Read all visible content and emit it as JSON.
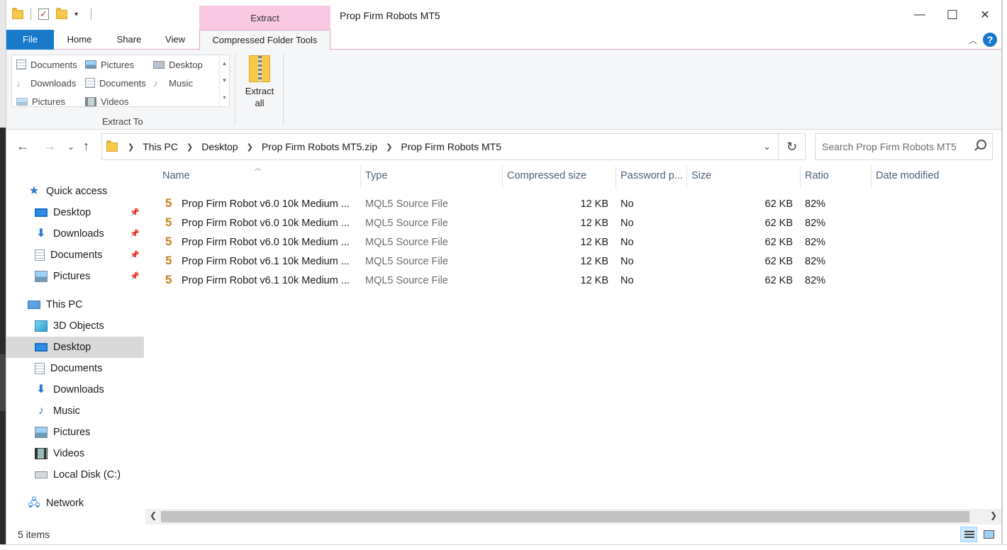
{
  "window": {
    "title": "Prop Firm Robots MT5",
    "contextual_tab_header": "Extract",
    "minimize_glyph": "—",
    "maximize_glyph": "☐",
    "close_glyph": "✕"
  },
  "quick_access_toolbar": {
    "dropdown_glyph": "▾",
    "icons": [
      "folder-icon",
      "properties-icon",
      "new-folder-icon"
    ]
  },
  "tabs": {
    "file": "File",
    "home": "Home",
    "share": "Share",
    "view": "View",
    "compressed": "Compressed Folder Tools"
  },
  "ribbon": {
    "extract_to_items": [
      {
        "label": "Documents",
        "icon": "documents-icon"
      },
      {
        "label": "Pictures",
        "icon": "pictures-icon"
      },
      {
        "label": "Desktop",
        "icon": "desktop-icon"
      },
      {
        "label": "Downloads",
        "icon": "downloads-icon"
      },
      {
        "label": "Documents",
        "icon": "documents-icon"
      },
      {
        "label": "Music",
        "icon": "music-icon"
      },
      {
        "label": "Pictures",
        "icon": "pictures-icon"
      },
      {
        "label": "Videos",
        "icon": "videos-icon"
      }
    ],
    "group_label": "Extract To",
    "extract_all_line1": "Extract",
    "extract_all_line2": "all"
  },
  "address": {
    "crumbs": [
      "This PC",
      "Desktop",
      "Prop Firm Robots MT5.zip",
      "Prop Firm Robots MT5"
    ],
    "search_placeholder": "Search Prop Firm Robots MT5"
  },
  "nav_pane": {
    "quick_access": "Quick access",
    "quick_items": [
      "Desktop",
      "Downloads",
      "Documents",
      "Pictures"
    ],
    "this_pc": "This PC",
    "pc_items": [
      "3D Objects",
      "Desktop",
      "Documents",
      "Downloads",
      "Music",
      "Pictures",
      "Videos",
      "Local Disk (C:)"
    ],
    "selected": "Desktop",
    "network": "Network"
  },
  "columns": {
    "name": "Name",
    "type": "Type",
    "compressed_size": "Compressed size",
    "password": "Password p...",
    "size": "Size",
    "ratio": "Ratio",
    "date_modified": "Date modified"
  },
  "files": [
    {
      "name": "Prop Firm Robot v6.0 10k Medium ...",
      "type": "MQL5 Source File",
      "compressed_size": "12 KB",
      "password": "No",
      "size": "62 KB",
      "ratio": "82%"
    },
    {
      "name": "Prop Firm Robot v6.0 10k Medium ...",
      "type": "MQL5 Source File",
      "compressed_size": "12 KB",
      "password": "No",
      "size": "62 KB",
      "ratio": "82%"
    },
    {
      "name": "Prop Firm Robot v6.0 10k Medium ...",
      "type": "MQL5 Source File",
      "compressed_size": "12 KB",
      "password": "No",
      "size": "62 KB",
      "ratio": "82%"
    },
    {
      "name": "Prop Firm Robot v6.1 10k Medium ...",
      "type": "MQL5 Source File",
      "compressed_size": "12 KB",
      "password": "No",
      "size": "62 KB",
      "ratio": "82%"
    },
    {
      "name": "Prop Firm Robot v6.1 10k Medium ...",
      "type": "MQL5 Source File",
      "compressed_size": "12 KB",
      "password": "No",
      "size": "62 KB",
      "ratio": "82%"
    }
  ],
  "file_icon_glyph": "5",
  "status": {
    "item_count": "5 items"
  },
  "colors": {
    "accent": "#1979ca",
    "contextual_tab": "#f9c9e3",
    "selection": "#d9d9d9",
    "file_icon": "#c7821b"
  }
}
